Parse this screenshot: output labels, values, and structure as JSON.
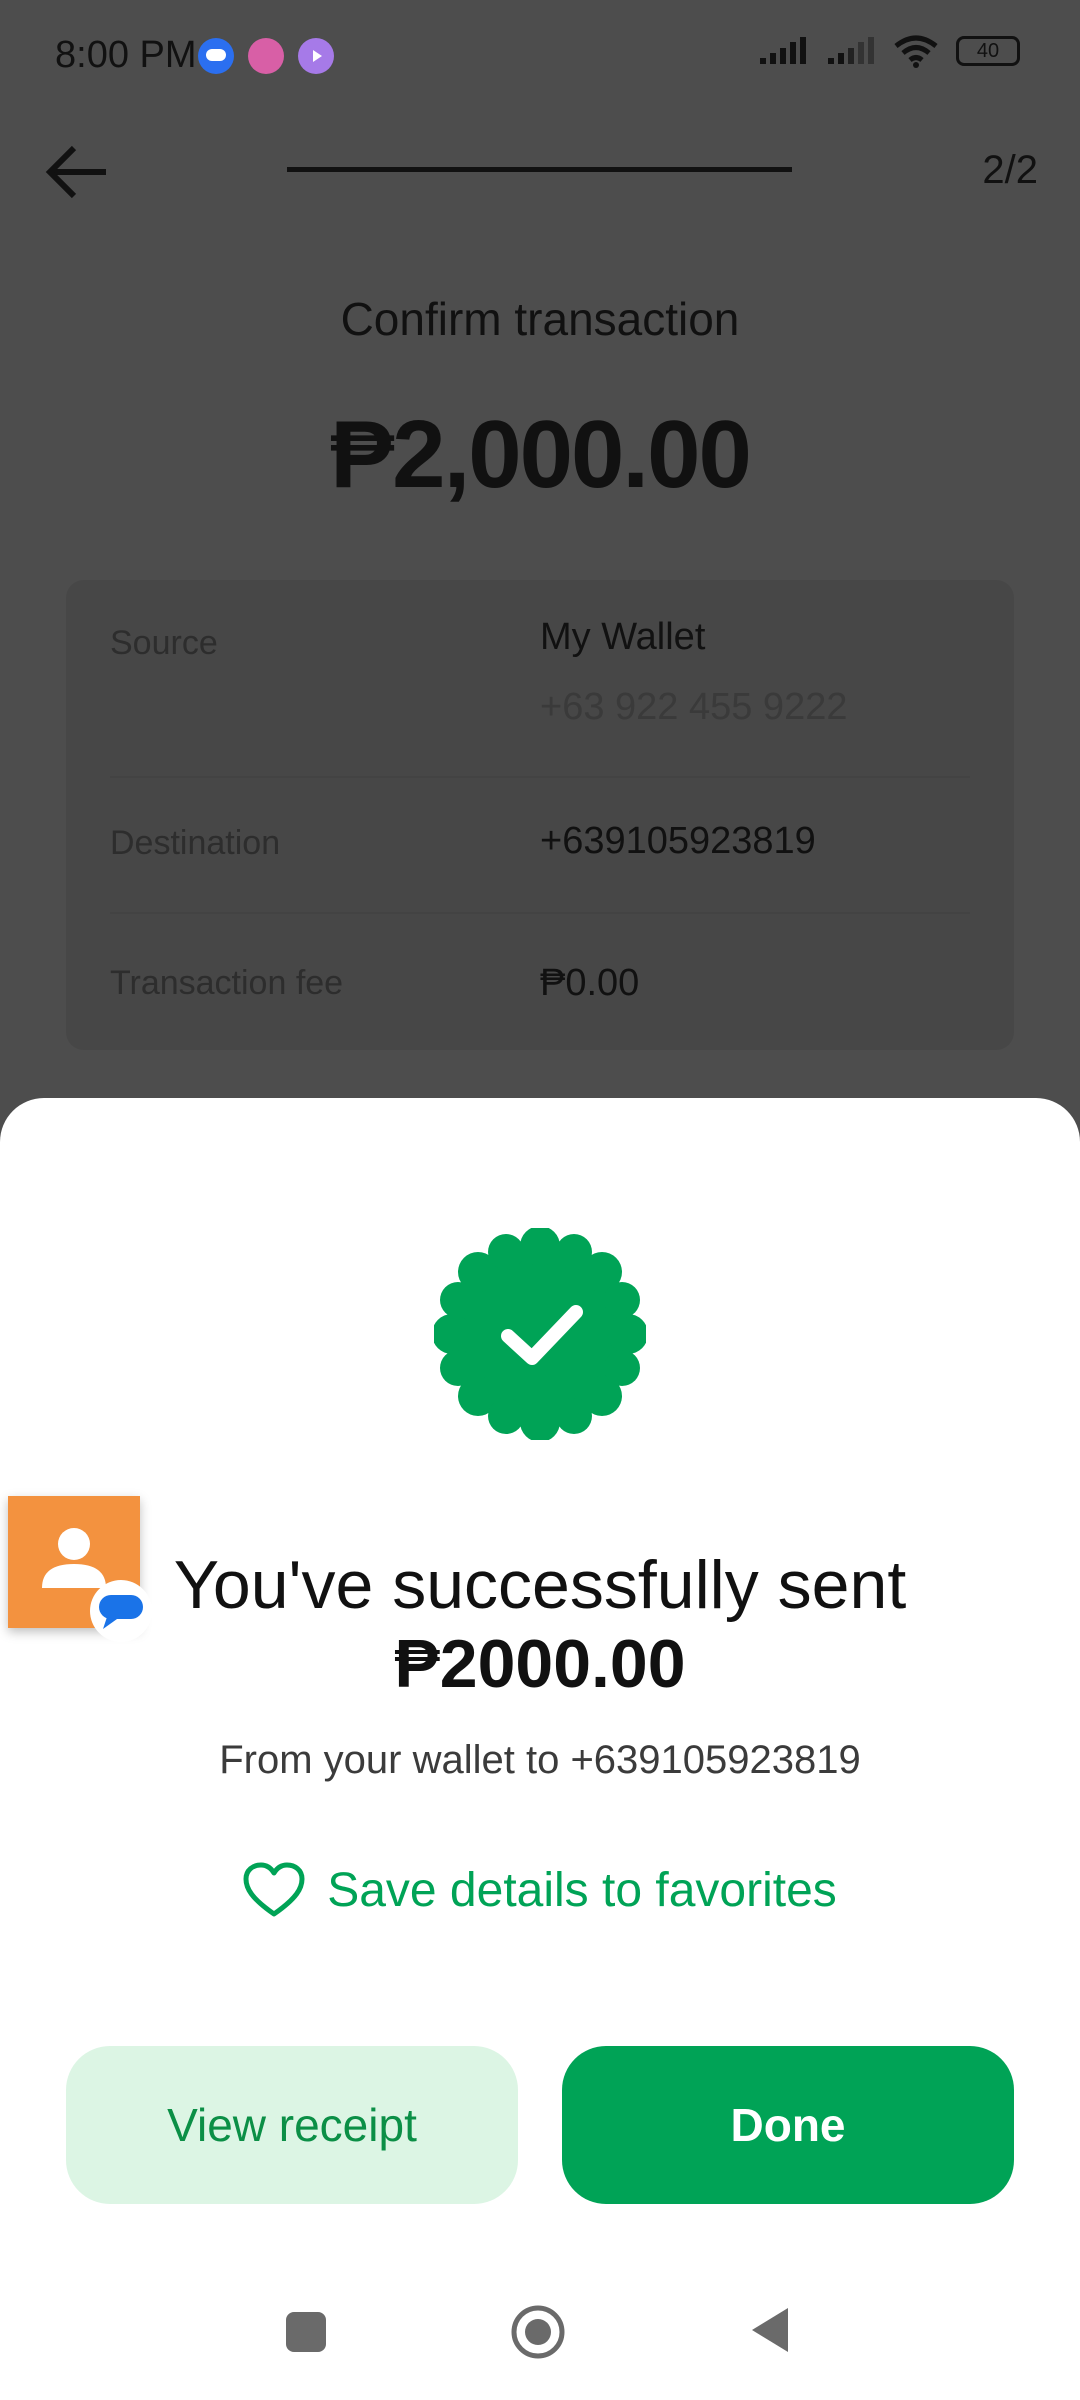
{
  "status_bar": {
    "time": "8:00 PM",
    "battery": "40"
  },
  "header": {
    "step": "2/2"
  },
  "confirm": {
    "title": "Confirm transaction",
    "amount": "₱2,000.00",
    "rows": [
      {
        "label": "Source",
        "value": "My Wallet",
        "sub": "+63 922 455 9222"
      },
      {
        "label": "Destination",
        "value": "+639105923819"
      },
      {
        "label": "Transaction fee",
        "value": "₱0.00"
      }
    ]
  },
  "success": {
    "title": "You've successfully sent",
    "amount": "₱2000.00",
    "subtitle": "From your wallet to +639105923819",
    "favorite_label": "Save details to favorites",
    "view_receipt_label": "View receipt",
    "done_label": "Done"
  },
  "colors": {
    "accent": "#00a356",
    "accent_light": "#dcf5e4",
    "chat_head": "#f3923f"
  },
  "icons": [
    "back-arrow-icon",
    "check-badge-icon",
    "heart-icon",
    "person-icon",
    "message-bubble-icon",
    "wifi-icon",
    "signal-icon",
    "battery-icon"
  ]
}
